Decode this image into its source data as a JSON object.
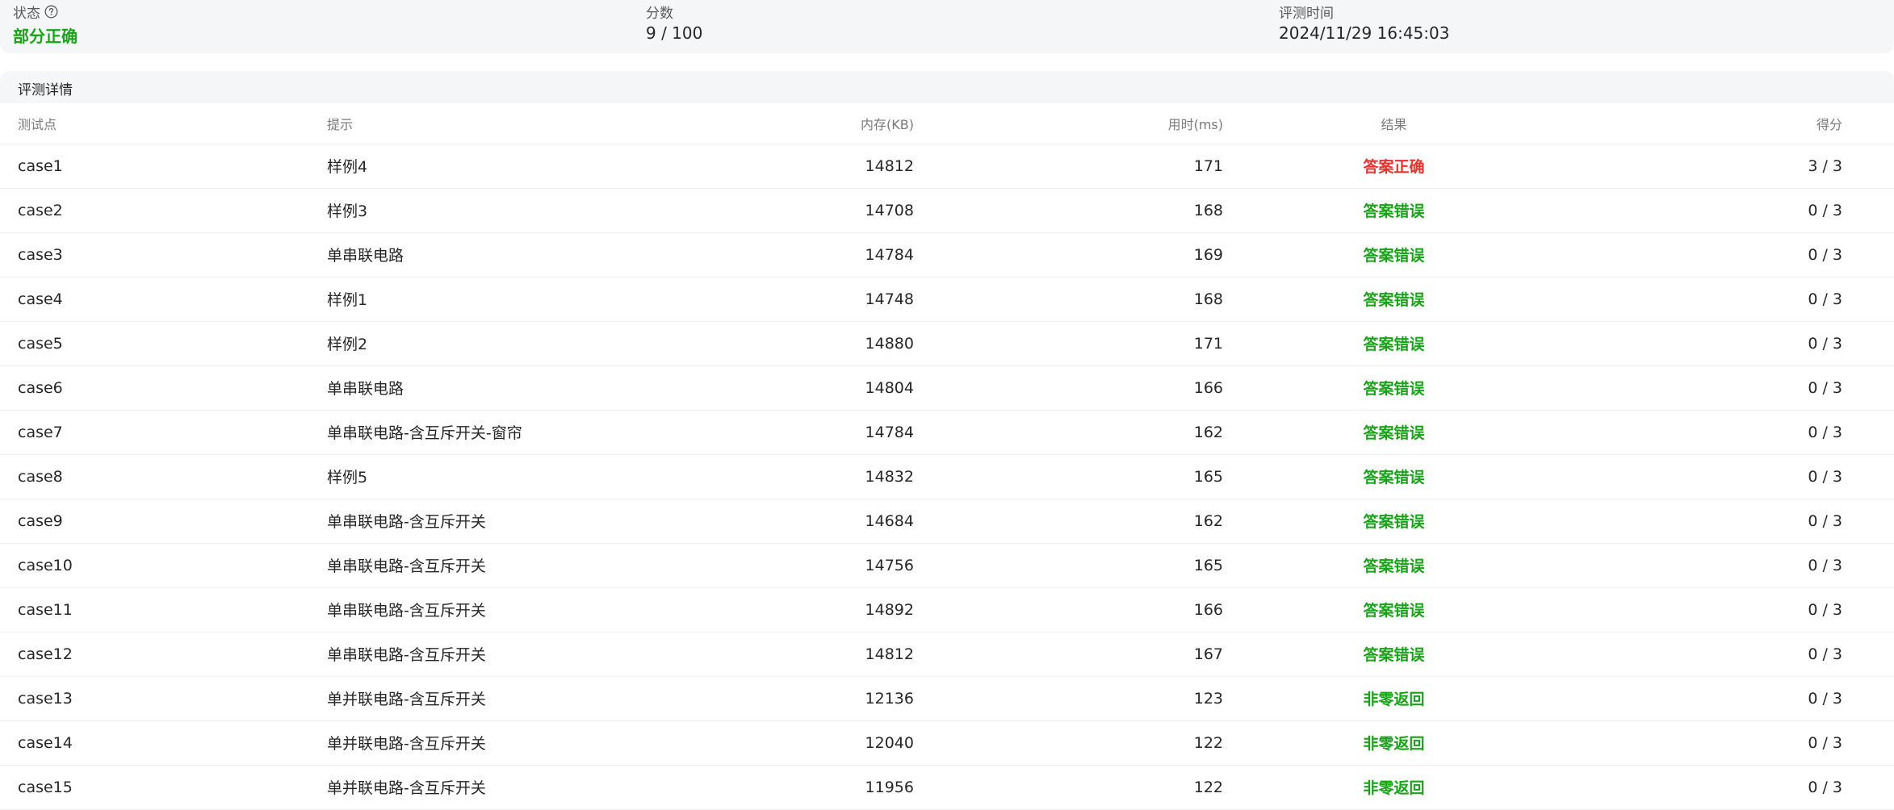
{
  "summary": {
    "status_label": "状态",
    "status_value": "部分正确",
    "score_label": "分数",
    "score_value": "9 / 100",
    "time_label": "评测时间",
    "time_value": "2024/11/29 16:45:03"
  },
  "details": {
    "title": "评测详情",
    "columns": {
      "case": "测试点",
      "hint": "提示",
      "memory": "内存(KB)",
      "time": "用时(ms)",
      "result": "结果",
      "score": "得分"
    },
    "rows": [
      {
        "case": "case1",
        "hint": "样例4",
        "memory": "14812",
        "time": "171",
        "result": "答案正确",
        "result_kind": "ac",
        "score": "3 / 3"
      },
      {
        "case": "case2",
        "hint": "样例3",
        "memory": "14708",
        "time": "168",
        "result": "答案错误",
        "result_kind": "wa",
        "score": "0 / 3"
      },
      {
        "case": "case3",
        "hint": "单串联电路",
        "memory": "14784",
        "time": "169",
        "result": "答案错误",
        "result_kind": "wa",
        "score": "0 / 3"
      },
      {
        "case": "case4",
        "hint": "样例1",
        "memory": "14748",
        "time": "168",
        "result": "答案错误",
        "result_kind": "wa",
        "score": "0 / 3"
      },
      {
        "case": "case5",
        "hint": "样例2",
        "memory": "14880",
        "time": "171",
        "result": "答案错误",
        "result_kind": "wa",
        "score": "0 / 3"
      },
      {
        "case": "case6",
        "hint": "单串联电路",
        "memory": "14804",
        "time": "166",
        "result": "答案错误",
        "result_kind": "wa",
        "score": "0 / 3"
      },
      {
        "case": "case7",
        "hint": "单串联电路-含互斥开关-窗帘",
        "memory": "14784",
        "time": "162",
        "result": "答案错误",
        "result_kind": "wa",
        "score": "0 / 3"
      },
      {
        "case": "case8",
        "hint": "样例5",
        "memory": "14832",
        "time": "165",
        "result": "答案错误",
        "result_kind": "wa",
        "score": "0 / 3"
      },
      {
        "case": "case9",
        "hint": "单串联电路-含互斥开关",
        "memory": "14684",
        "time": "162",
        "result": "答案错误",
        "result_kind": "wa",
        "score": "0 / 3"
      },
      {
        "case": "case10",
        "hint": "单串联电路-含互斥开关",
        "memory": "14756",
        "time": "165",
        "result": "答案错误",
        "result_kind": "wa",
        "score": "0 / 3"
      },
      {
        "case": "case11",
        "hint": "单串联电路-含互斥开关",
        "memory": "14892",
        "time": "166",
        "result": "答案错误",
        "result_kind": "wa",
        "score": "0 / 3"
      },
      {
        "case": "case12",
        "hint": "单串联电路-含互斥开关",
        "memory": "14812",
        "time": "167",
        "result": "答案错误",
        "result_kind": "wa",
        "score": "0 / 3"
      },
      {
        "case": "case13",
        "hint": "单并联电路-含互斥开关",
        "memory": "12136",
        "time": "123",
        "result": "非零返回",
        "result_kind": "re",
        "score": "0 / 3"
      },
      {
        "case": "case14",
        "hint": "单并联电路-含互斥开关",
        "memory": "12040",
        "time": "122",
        "result": "非零返回",
        "result_kind": "re",
        "score": "0 / 3"
      },
      {
        "case": "case15",
        "hint": "单并联电路-含互斥开关",
        "memory": "11956",
        "time": "122",
        "result": "非零返回",
        "result_kind": "re",
        "score": "0 / 3"
      }
    ]
  },
  "colors": {
    "accepted": "#e8322d",
    "wrong": "#1ba21b",
    "status": "#1ba21b"
  },
  "icons": {
    "status_help": "question-circle-icon"
  }
}
